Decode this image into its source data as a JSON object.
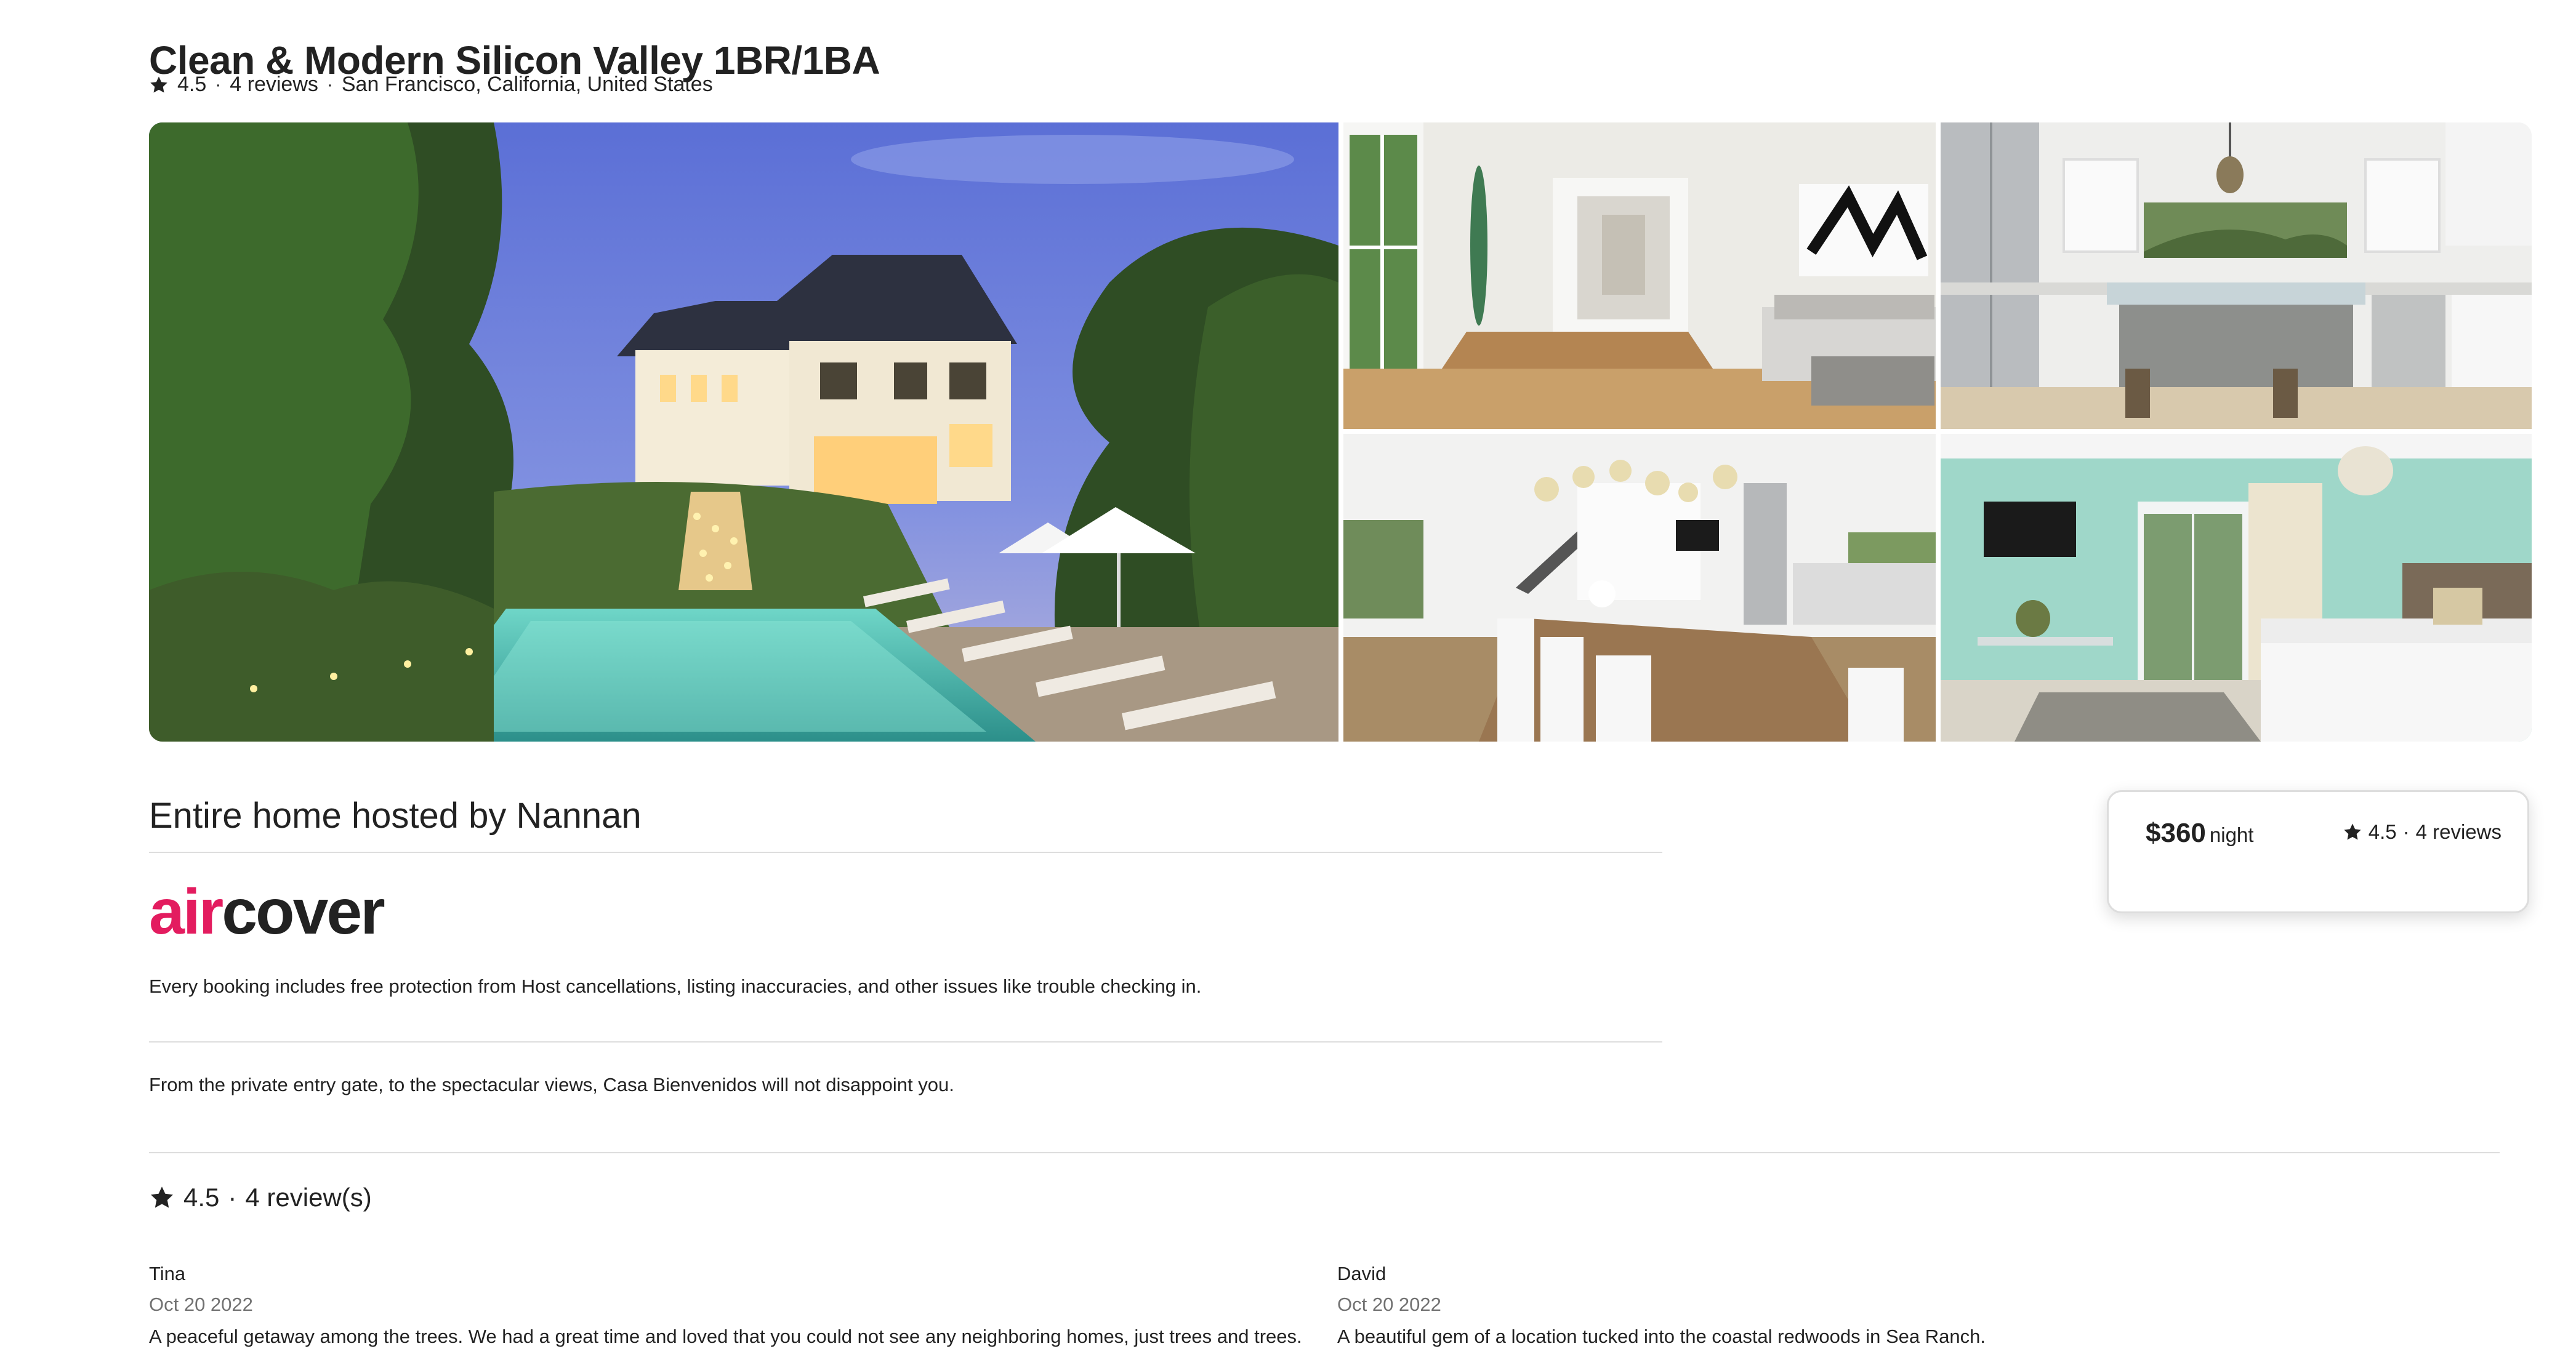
{
  "listing": {
    "title": "Clean & Modern Silicon Valley 1BR/1BA",
    "rating": "4.5",
    "reviews_link": "4 reviews",
    "location": "San Francisco, California, United States",
    "separator": "·"
  },
  "gallery": {
    "photos": [
      {
        "name": "main-photo-exterior-pool"
      },
      {
        "name": "photo-living-room"
      },
      {
        "name": "photo-kitchen"
      },
      {
        "name": "photo-dining-room"
      },
      {
        "name": "photo-bedroom"
      }
    ]
  },
  "hosting": {
    "headline": "Entire home hosted by Nannan"
  },
  "aircover": {
    "brand_air": "air",
    "brand_cover": "cover",
    "description": "Every booking includes free protection from Host cancellations, listing inaccuracies, and other issues like trouble checking in."
  },
  "description": "From the private entry gate, to the spectacular views, Casa Bienvenidos will not disappoint you.",
  "reviews": {
    "rating": "4.5",
    "separator": "·",
    "count_label": "4 review(s)",
    "items": [
      {
        "name": "Tina",
        "date": "Oct 20 2022",
        "text": "A peaceful getaway among the trees. We had a great time and loved that you could not see any neighboring homes, just trees and trees."
      },
      {
        "name": "David",
        "date": "Oct 20 2022",
        "text": "A beautiful gem of a location tucked into the coastal redwoods in Sea Ranch."
      }
    ]
  },
  "booking_card": {
    "price": "$360",
    "unit": "night",
    "rating": "4.5",
    "separator": "·",
    "reviews": "4 reviews"
  },
  "colors": {
    "brand": "#e31c5f",
    "text": "#222222",
    "muted": "#717171",
    "divider": "#dddddd"
  },
  "icons": [
    "star-icon"
  ]
}
